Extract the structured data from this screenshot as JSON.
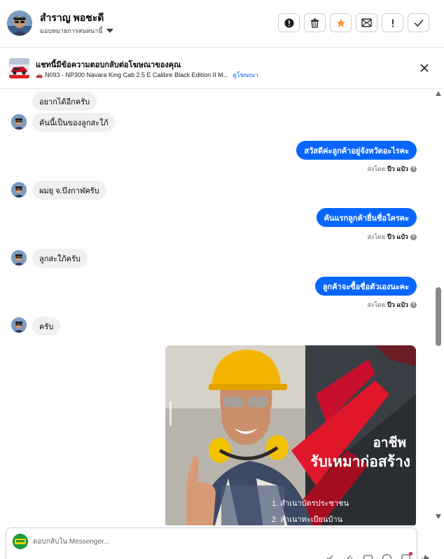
{
  "header": {
    "contact_name": "สำราญ พอชะดี",
    "assign_label": "มอบหมายการสนทนานี้",
    "actions": [
      {
        "name": "report-button",
        "icon": "exclamation-circle-icon"
      },
      {
        "name": "delete-button",
        "icon": "trash-icon"
      },
      {
        "name": "star-button",
        "icon": "star-icon",
        "color": "#f7923a"
      },
      {
        "name": "mark-unread-button",
        "icon": "mail-icon"
      },
      {
        "name": "follow-up-button",
        "icon": "exclamation-icon"
      },
      {
        "name": "done-button",
        "icon": "check-icon"
      }
    ]
  },
  "ad": {
    "title": "แชทนี้มีข้อความตอบกลับต่อโฆษณาของคุณ",
    "car_icon": "🚗",
    "subtitle": "N093 - NP300 Navara King Cab 2.5 E Calibre Black Edition II M...",
    "link": "ดูโฆษณา"
  },
  "messages": {
    "in1": "อยากได้อีกครับ",
    "in2": "คันนี้เป็นของลูกสะใภ้",
    "out1": "สวัสดีค่ะลูกค้าอยู่จังหวัดอะไรคะ",
    "in3": "ผมยุ จ.บึงกาฬครับ",
    "out2": "คันแรกลูกค้ายื่นชื่อใครคะ",
    "in4": "ลูกสะใภ้ครับ",
    "out3": "ลูกค้าจะซื้อชื่อตัวเองนะคะ",
    "in5": "ครับ"
  },
  "sent_by": {
    "prefix": "ส่งโดย",
    "agent": "ปีว แป๋ว",
    "help": "?"
  },
  "promo": {
    "title_line1": "อาชีพ",
    "title_line2": "รับเหมาก่อสร้าง",
    "items": [
      "1. สำเนาบัตรประชาชน",
      "2. สำเนาทะเบียนบ้าน"
    ]
  },
  "reply": {
    "placeholder": "ตอบกลับใน Messenger...",
    "tools": [
      "link-icon",
      "attachment-icon",
      "gif-icon",
      "emoji-icon",
      "sticker-icon",
      "like-icon"
    ]
  },
  "colors": {
    "accent": "#0866ff",
    "incoming_bubble": "#f0f0f0",
    "star": "#f7923a"
  }
}
